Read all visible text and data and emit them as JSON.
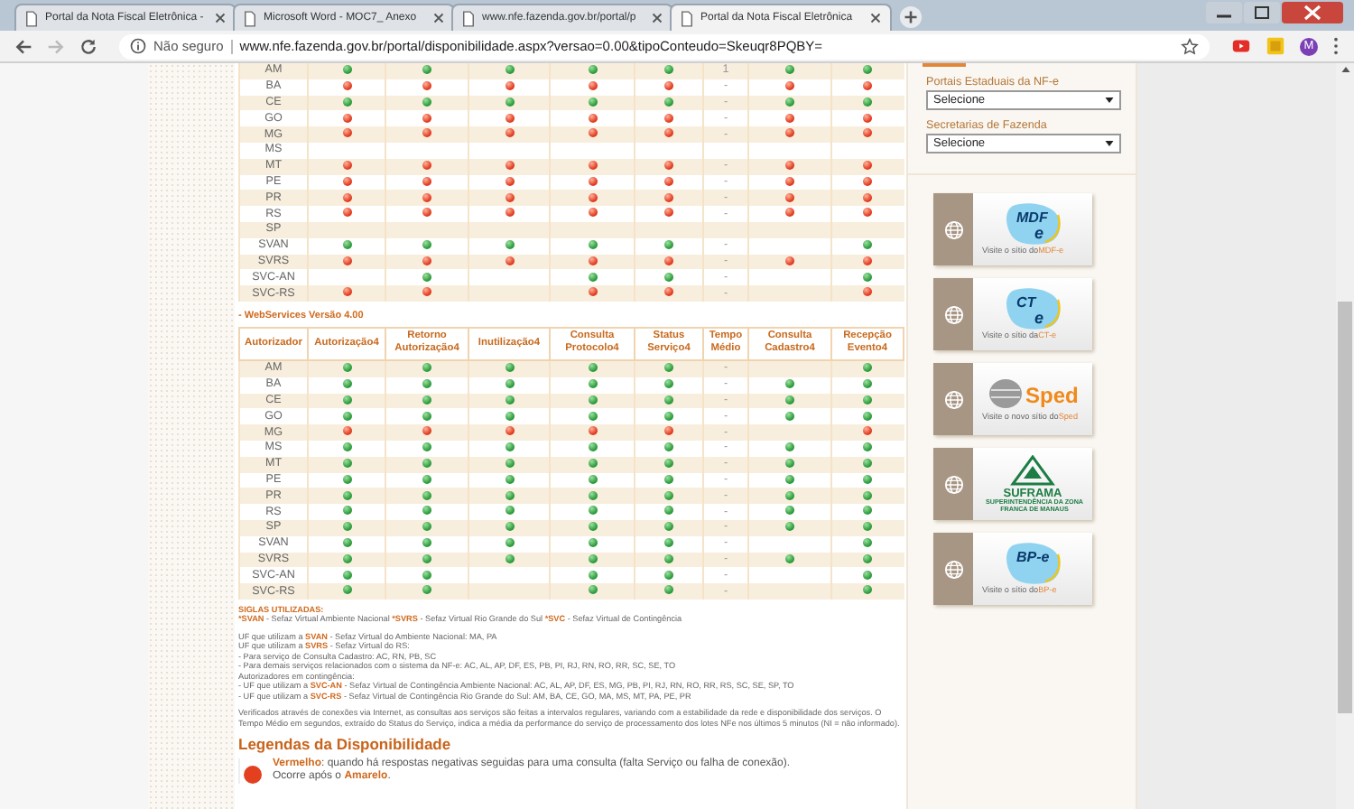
{
  "browser": {
    "tabs": [
      {
        "title": "Portal da Nota Fiscal Eletrônica -",
        "selected": false
      },
      {
        "title": "Microsoft Word - MOC7_ Anexo",
        "selected": false
      },
      {
        "title": "www.nfe.fazenda.gov.br/portal/p",
        "selected": false
      },
      {
        "title": "Portal da Nota Fiscal Eletrônica",
        "selected": true
      }
    ],
    "security": "Não seguro",
    "url": "www.nfe.fazenda.gov.br/portal/disponibilidade.aspx?versao=0.00&tipoConteudo=Skeuqr8PQBY=",
    "profile": "M"
  },
  "tables": [
    {
      "rows": [
        {
          "name": "AM",
          "services": [
            {
              "online": true
            },
            {
              "online": true
            },
            {
              "online": true
            },
            {
              "online": true
            },
            {
              "online": true
            },
            {
              "online": true
            },
            {
              "online": true
            }
          ],
          "tempo": "1"
        },
        {
          "name": "BA",
          "services": [
            {
              "online": false
            },
            {
              "online": false
            },
            {
              "online": false
            },
            {
              "online": false
            },
            {
              "online": false
            },
            {
              "online": false
            },
            {
              "online": false
            }
          ],
          "tempo": "-"
        },
        {
          "name": "CE",
          "services": [
            {
              "online": true
            },
            {
              "online": true
            },
            {
              "online": true
            },
            {
              "online": true
            },
            {
              "online": true
            },
            {
              "online": true
            },
            {
              "online": true
            }
          ],
          "tempo": "-"
        },
        {
          "name": "GO",
          "services": [
            {
              "online": false
            },
            {
              "online": false
            },
            {
              "online": false
            },
            {
              "online": false
            },
            {
              "online": false
            },
            {
              "online": false
            },
            {
              "online": false
            }
          ],
          "tempo": "-"
        },
        {
          "name": "MG",
          "services": [
            {
              "online": false
            },
            {
              "online": false
            },
            {
              "online": false
            },
            {
              "online": false
            },
            {
              "online": false
            },
            {
              "online": false
            },
            {
              "online": false
            }
          ],
          "tempo": "-"
        },
        {
          "name": "MS",
          "services": [
            {
              "empty": true
            },
            {
              "empty": true
            },
            {
              "empty": true
            },
            {
              "empty": true
            },
            {
              "empty": true
            },
            {
              "empty": true
            },
            {
              "empty": true
            }
          ]
        },
        {
          "name": "MT",
          "services": [
            {
              "online": false
            },
            {
              "online": false
            },
            {
              "online": false
            },
            {
              "online": false
            },
            {
              "online": false
            },
            {
              "online": false
            },
            {
              "online": false
            }
          ],
          "tempo": "-"
        },
        {
          "name": "PE",
          "services": [
            {
              "online": false
            },
            {
              "online": false
            },
            {
              "online": false
            },
            {
              "online": false
            },
            {
              "online": false
            },
            {
              "online": false
            },
            {
              "online": false
            }
          ],
          "tempo": "-"
        },
        {
          "name": "PR",
          "services": [
            {
              "online": false
            },
            {
              "online": false
            },
            {
              "online": false
            },
            {
              "online": false
            },
            {
              "online": false
            },
            {
              "online": false
            },
            {
              "online": false
            }
          ],
          "tempo": "-"
        },
        {
          "name": "RS",
          "services": [
            {
              "online": false
            },
            {
              "online": false
            },
            {
              "online": false
            },
            {
              "online": false
            },
            {
              "online": false
            },
            {
              "online": false
            },
            {
              "online": false
            }
          ],
          "tempo": "-"
        },
        {
          "name": "SP",
          "services": [
            {
              "empty": true
            },
            {
              "empty": true
            },
            {
              "empty": true
            },
            {
              "empty": true
            },
            {
              "empty": true
            },
            {
              "empty": true
            },
            {
              "empty": true
            }
          ]
        },
        {
          "name": "SVAN",
          "services": [
            {
              "online": true
            },
            {
              "online": true
            },
            {
              "online": true
            },
            {
              "online": true
            },
            {
              "online": true
            },
            {
              "empty": true
            },
            {
              "online": true
            }
          ],
          "tempo": "-"
        },
        {
          "name": "SVRS",
          "services": [
            {
              "online": false
            },
            {
              "online": false
            },
            {
              "online": false
            },
            {
              "online": false
            },
            {
              "online": false
            },
            {
              "online": false
            },
            {
              "online": false
            }
          ],
          "tempo": "-"
        },
        {
          "name": "SVC-AN",
          "services": [
            {
              "empty": true
            },
            {
              "online": true
            },
            {
              "empty": true
            },
            {
              "online": true
            },
            {
              "online": true
            },
            {
              "empty": true
            },
            {
              "online": true
            }
          ],
          "tempo": "-"
        },
        {
          "name": "SVC-RS",
          "services": [
            {
              "online": false
            },
            {
              "online": false
            },
            {
              "empty": true
            },
            {
              "online": false
            },
            {
              "online": false
            },
            {
              "empty": true
            },
            {
              "online": false
            }
          ],
          "tempo": "-"
        }
      ]
    },
    {
      "title": "- WebServices Versão 4.00",
      "columns": [
        "Autorizador",
        "Autorização4",
        "Retorno Autorização4",
        "Inutilização4",
        "Consulta Protocolo4",
        "Status Serviço4",
        "Tempo Médio",
        "Consulta Cadastro4",
        "Recepção Evento4"
      ],
      "rows": [
        {
          "name": "AM",
          "services": [
            {
              "online": true
            },
            {
              "online": true
            },
            {
              "online": true
            },
            {
              "online": true
            },
            {
              "online": true
            },
            {
              "empty": true
            },
            {
              "online": true
            }
          ],
          "tempo": "-"
        },
        {
          "name": "BA",
          "services": [
            {
              "online": true
            },
            {
              "online": true
            },
            {
              "online": true
            },
            {
              "online": true
            },
            {
              "online": true
            },
            {
              "online": true
            },
            {
              "online": true
            }
          ],
          "tempo": "-"
        },
        {
          "name": "CE",
          "services": [
            {
              "online": true
            },
            {
              "online": true
            },
            {
              "online": true
            },
            {
              "online": true
            },
            {
              "online": true
            },
            {
              "online": true
            },
            {
              "online": true
            }
          ],
          "tempo": "-"
        },
        {
          "name": "GO",
          "services": [
            {
              "online": true
            },
            {
              "online": true
            },
            {
              "online": true
            },
            {
              "online": true
            },
            {
              "online": true
            },
            {
              "online": true
            },
            {
              "online": true
            }
          ],
          "tempo": "-"
        },
        {
          "name": "MG",
          "services": [
            {
              "online": false
            },
            {
              "online": false
            },
            {
              "online": false
            },
            {
              "online": false
            },
            {
              "online": false
            },
            {
              "empty": true
            },
            {
              "online": false
            }
          ],
          "tempo": "-"
        },
        {
          "name": "MS",
          "services": [
            {
              "online": true
            },
            {
              "online": true
            },
            {
              "online": true
            },
            {
              "online": true
            },
            {
              "online": true
            },
            {
              "online": true
            },
            {
              "online": true
            }
          ],
          "tempo": "-"
        },
        {
          "name": "MT",
          "services": [
            {
              "online": true
            },
            {
              "online": true
            },
            {
              "online": true
            },
            {
              "online": true
            },
            {
              "online": true
            },
            {
              "online": true
            },
            {
              "online": true
            }
          ],
          "tempo": "-"
        },
        {
          "name": "PE",
          "services": [
            {
              "online": true
            },
            {
              "online": true
            },
            {
              "online": true
            },
            {
              "online": true
            },
            {
              "online": true
            },
            {
              "online": true
            },
            {
              "online": true
            }
          ],
          "tempo": "-"
        },
        {
          "name": "PR",
          "services": [
            {
              "online": true
            },
            {
              "online": true
            },
            {
              "online": true
            },
            {
              "online": true
            },
            {
              "online": true
            },
            {
              "online": true
            },
            {
              "online": true
            }
          ],
          "tempo": "-"
        },
        {
          "name": "RS",
          "services": [
            {
              "online": true
            },
            {
              "online": true
            },
            {
              "online": true
            },
            {
              "online": true
            },
            {
              "online": true
            },
            {
              "online": true
            },
            {
              "online": true
            }
          ],
          "tempo": "-"
        },
        {
          "name": "SP",
          "services": [
            {
              "online": true
            },
            {
              "online": true
            },
            {
              "online": true
            },
            {
              "online": true
            },
            {
              "online": true
            },
            {
              "online": true
            },
            {
              "online": true
            }
          ],
          "tempo": "-"
        },
        {
          "name": "SVAN",
          "services": [
            {
              "online": true
            },
            {
              "online": true
            },
            {
              "online": true
            },
            {
              "online": true
            },
            {
              "online": true
            },
            {
              "empty": true
            },
            {
              "online": true
            }
          ],
          "tempo": "-"
        },
        {
          "name": "SVRS",
          "services": [
            {
              "online": true
            },
            {
              "online": true
            },
            {
              "online": true
            },
            {
              "online": true
            },
            {
              "online": true
            },
            {
              "online": true
            },
            {
              "online": true
            }
          ],
          "tempo": "-"
        },
        {
          "name": "SVC-AN",
          "services": [
            {
              "online": true
            },
            {
              "online": true
            },
            {
              "empty": true
            },
            {
              "online": true
            },
            {
              "online": true
            },
            {
              "empty": true
            },
            {
              "online": true
            }
          ],
          "tempo": "-"
        },
        {
          "name": "SVC-RS",
          "services": [
            {
              "online": true
            },
            {
              "online": true
            },
            {
              "empty": true
            },
            {
              "online": true
            },
            {
              "online": true
            },
            {
              "empty": true
            },
            {
              "online": true
            }
          ],
          "tempo": "-"
        }
      ]
    }
  ],
  "notes": {
    "title": "SIGLAS UTILIZADAS:",
    "paragraphs": [
      [
        "***SVAN** - Sefaz Virtual Ambiente Nacional ***SVRS** - Sefaz Virtual Rio Grande do Sul ***SVC** - Sefaz Virtual de Contingência"
      ],
      [
        "UF que utilizam a **SVAN** - Sefaz Virtual do Ambiente Nacional: MA, PA",
        "UF que utilizam a **SVRS** - Sefaz Virtual do RS:",
        "- Para serviço de Consulta Cadastro: AC, RN, PB, SC",
        "- Para demais serviços relacionados com o sistema da NF-e: AC, AL, AP, DF, ES, PB, PI, RJ, RN, RO, RR, SC, SE, TO",
        "Autorizadores em contingência:",
        "- UF que utilizam a **SVC-AN** - Sefaz Virtual de Contingência Ambiente Nacional: AC, AL, AP, DF, ES, MG, PB, PI, RJ, RN, RO, RR, RS, SC, SE, SP, TO",
        "- UF que utilizam a **SVC-RS** - Sefaz Virtual de Contingência Rio Grande do Sul: AM, BA, CE, GO, MA, MS, MT, PA, PE, PR"
      ],
      [
        "Verificados através de conexões via Internet, as consultas aos serviços são feitas a intervalos regulares, variando com a estabilidade da rede e disponibilidade dos serviços. O Tempo Médio em segundos, extraído do Status do Serviço, indica a média da performance do serviço de processamento dos lotes NFe nos últimos 5 minutos (NI = não informado)."
      ]
    ]
  },
  "legend": {
    "title": "Legendas da Disponibilidade",
    "items": [
      {
        "color": "#e2401e",
        "lines": [
          "**Vermelho**: quando há respostas negativas seguidas para uma consulta (falta Serviço ou falha de conexão).",
          "Ocorre após o **Amarelo**."
        ]
      }
    ]
  },
  "sidebar": {
    "selects": [
      {
        "label": "Portais Estaduais da NF-e",
        "value": "Selecione"
      },
      {
        "label": "Secretarias de Fazenda",
        "value": "Selecione"
      }
    ],
    "banners": [
      {
        "kind": "map",
        "logo": "MDF e",
        "caption": "Visite o sítio do",
        "link": "MDF-e"
      },
      {
        "kind": "map",
        "logo": "CT e",
        "caption": "Visite o sítio da",
        "link": "CT-e"
      },
      {
        "kind": "sped",
        "logo": "Sped",
        "caption": "Visite o novo sítio do",
        "link": "Sped"
      },
      {
        "kind": "triangle",
        "logo": "SUFRAMA",
        "caption": "SUPERINTENDÊNCIA DA ZONA FRANCA DE MANAUS"
      },
      {
        "kind": "map",
        "logo": "BP-e",
        "caption": "Visite o sítio do",
        "link": "BP-e"
      }
    ]
  }
}
